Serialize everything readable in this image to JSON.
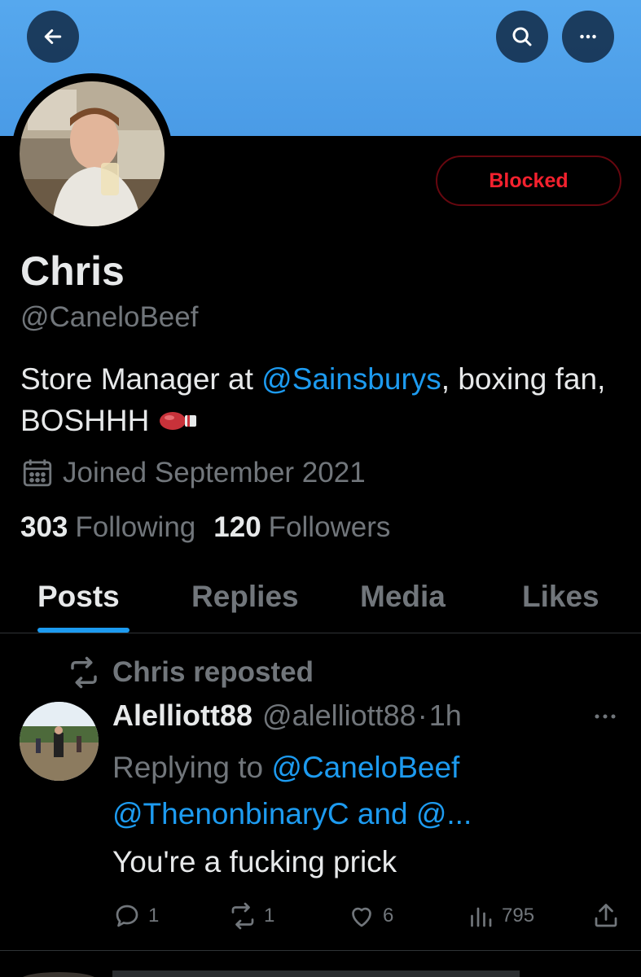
{
  "header": {
    "back_icon": "arrow-left-icon",
    "search_icon": "search-icon",
    "more_icon": "more-horizontal-icon",
    "banner_color": "#4a9be6"
  },
  "profile": {
    "name": "Chris",
    "handle": "@CaneloBeef",
    "blocked_label": "Blocked",
    "bio": {
      "part1": "Store Manager at ",
      "mention": "@Sainsburys",
      "part2": ", boxing fan, BOSHHH "
    },
    "joined": "Joined September 2021",
    "following_count": "303",
    "following_label": "Following",
    "followers_count": "120",
    "followers_label": "Followers"
  },
  "tabs": [
    {
      "label": "Posts",
      "active": true
    },
    {
      "label": "Replies",
      "active": false
    },
    {
      "label": "Media",
      "active": false
    },
    {
      "label": "Likes",
      "active": false
    }
  ],
  "post": {
    "repost_label": "Chris reposted",
    "author_name": "Alelliott88",
    "author_handle": "@alelliott88",
    "separator": "·",
    "time": "1h",
    "replying_prefix": "Replying to ",
    "replying_mention1": "@CaneloBeef",
    "replying_mention2": "@ThenonbinaryC and @...",
    "text": "You're a fucking prick",
    "replies": "1",
    "reposts": "1",
    "likes": "6",
    "views": "795"
  },
  "colors": {
    "accent": "#1d9bf0",
    "blocked_red": "#f4212e",
    "muted": "#71767b",
    "text": "#e7e9ea"
  }
}
